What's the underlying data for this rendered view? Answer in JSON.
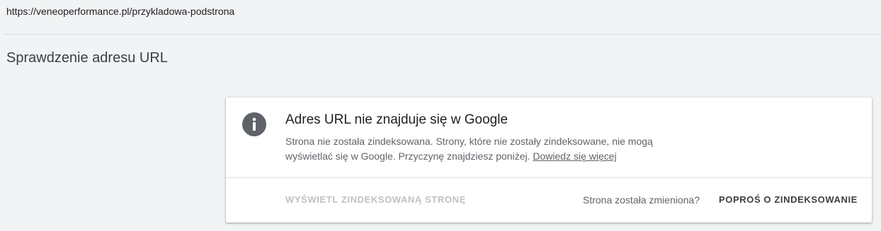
{
  "url_bar": {
    "url": "https://veneoperformance.pl/przykladowa-podstrona"
  },
  "page": {
    "title": "Sprawdzenie adresu URL"
  },
  "status_card": {
    "icon": "info-icon",
    "heading": "Adres URL nie znajduje się w Google",
    "description": "Strona nie została zindeksowana. Strony, które nie zostały zindeksowane, nie mogą wyświetlać się w Google. Przyczynę znajdziesz poniżej.",
    "learn_more_label": "Dowiedz się więcej",
    "view_indexed_label": "Wyświetl zindeksowaną stronę",
    "changed_question": "Strona została zmieniona?",
    "request_indexing_label": "Poproś o zindeksowanie"
  },
  "colors": {
    "background": "#f1f3f4",
    "card": "#ffffff",
    "icon": "#5f6368",
    "disabled_text": "#bdc1c6"
  }
}
